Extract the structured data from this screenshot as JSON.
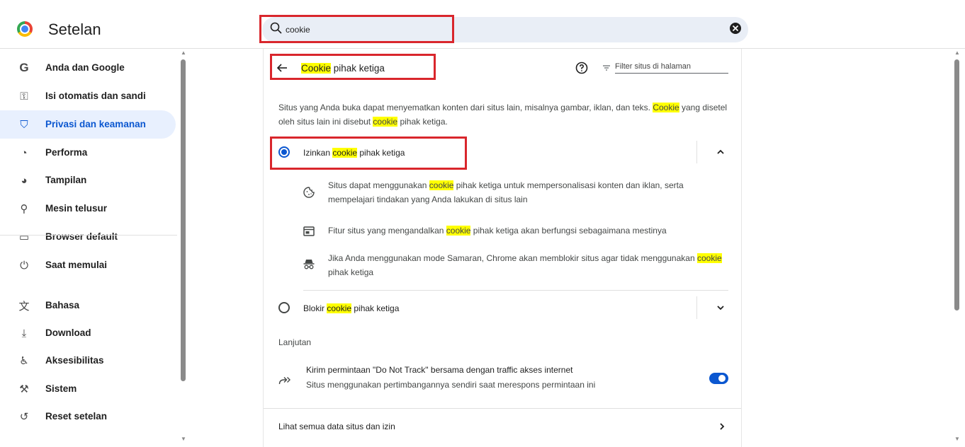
{
  "app": {
    "title": "Setelan"
  },
  "search": {
    "value": "cookie"
  },
  "sidebar": {
    "items": [
      {
        "label": "Anda dan Google",
        "icon": "google-g-icon",
        "glyph": "G"
      },
      {
        "label": "Isi otomatis dan sandi",
        "icon": "key-icon",
        "glyph": "⚿"
      },
      {
        "label": "Privasi dan keamanan",
        "icon": "shield-icon",
        "glyph": "⛉",
        "active": true
      },
      {
        "label": "Performa",
        "icon": "speedometer-icon",
        "glyph": "◔"
      },
      {
        "label": "Tampilan",
        "icon": "palette-icon",
        "glyph": "◕"
      },
      {
        "label": "Mesin telusur",
        "icon": "search-icon",
        "glyph": "⚲"
      },
      {
        "label": "Browser default",
        "icon": "browser-window-icon",
        "glyph": "▭"
      },
      {
        "label": "Saat memulai",
        "icon": "power-icon",
        "glyph": "⏻"
      },
      {
        "label": "Bahasa",
        "icon": "translate-icon",
        "glyph": "文"
      },
      {
        "label": "Download",
        "icon": "download-icon",
        "glyph": "⤓"
      },
      {
        "label": "Aksesibilitas",
        "icon": "accessibility-icon",
        "glyph": "♿"
      },
      {
        "label": "Sistem",
        "icon": "wrench-icon",
        "glyph": "⚒"
      },
      {
        "label": "Reset setelan",
        "icon": "reset-icon",
        "glyph": "↺"
      }
    ]
  },
  "page": {
    "title_highlight": "Cookie",
    "title_rest": " pihak ketiga",
    "filter_placeholder": "Filter situs di halaman",
    "description": {
      "part1": "Situs yang Anda buka dapat menyematkan konten dari situs lain, misalnya gambar, iklan, dan teks. ",
      "hl1": "Cookie",
      "part2": " yang disetel oleh situs lain ini disebut ",
      "hl2": "cookie",
      "part3": " pihak ketiga."
    }
  },
  "options": {
    "allow": {
      "pre": "Izinkan ",
      "hl": "cookie",
      "post": " pihak ketiga",
      "selected": true
    },
    "allow_details": [
      {
        "icon": "cookie-icon",
        "pre": "Situs dapat menggunakan ",
        "hl": "cookie",
        "post": " pihak ketiga untuk mempersonalisasi konten dan iklan, serta mempelajari tindakan yang Anda lakukan di situs lain"
      },
      {
        "icon": "web-page-icon",
        "pre": "Fitur situs yang mengandalkan ",
        "hl": "cookie",
        "post": " pihak ketiga akan berfungsi sebagaimana mestinya"
      },
      {
        "icon": "incognito-icon",
        "pre": "Jika Anda menggunakan mode Samaran, Chrome akan memblokir situs agar tidak menggunakan ",
        "hl": "cookie",
        "post": " pihak ketiga"
      }
    ],
    "block": {
      "pre": "Blokir ",
      "hl": "cookie",
      "post": " pihak ketiga",
      "selected": false
    }
  },
  "advanced": {
    "label": "Lanjutan",
    "dnt_title": "Kirim permintaan \"Do Not Track\" bersama dengan traffic akses internet",
    "dnt_sub": "Situs menggunakan pertimbangannya sendiri saat merespons permintaan ini",
    "dnt_enabled": true,
    "site_data": "Lihat semua data situs dan izin"
  },
  "colors": {
    "accent": "#0b57d0",
    "highlight": "#ffff00",
    "annotation": "#d9262c"
  }
}
